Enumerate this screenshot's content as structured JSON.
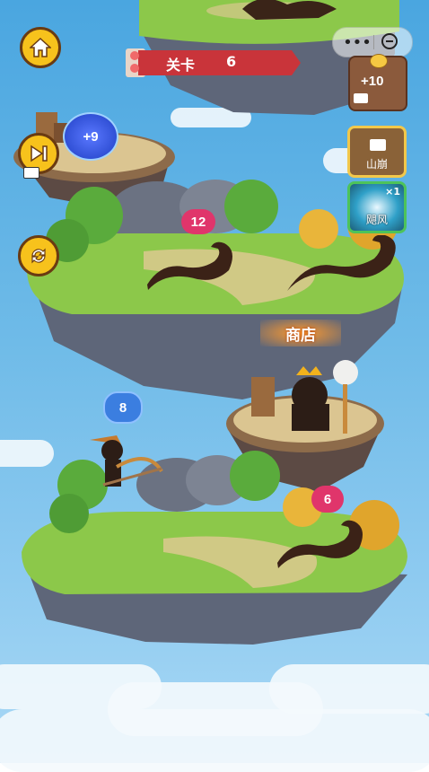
{
  "level_banner": {
    "label": "关卡",
    "number": "6"
  },
  "reward": {
    "amount": "+10"
  },
  "orb_bonus": "+9",
  "skills": [
    {
      "name": "山崩",
      "count": ""
    },
    {
      "name": "飓风",
      "count": "×1"
    }
  ],
  "enemies": [
    {
      "power": "12"
    },
    {
      "power": "6"
    }
  ],
  "player": {
    "power": "8"
  },
  "shop_label": "商店",
  "icons": {
    "home": "home-icon",
    "skip": "skip-icon",
    "refresh": "refresh-icon",
    "menu": "more-dots-icon",
    "close": "close-icon"
  },
  "colors": {
    "banner": "#c9343a",
    "button": "#f7c21c",
    "enemy_badge": "#e0356b",
    "player_badge": "#3b7ee0"
  }
}
